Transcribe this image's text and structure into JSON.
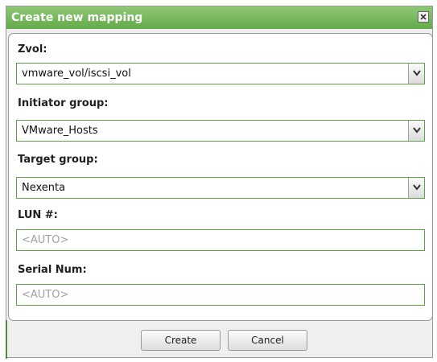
{
  "dialog": {
    "title": "Create new mapping",
    "close_icon": "close-x-icon"
  },
  "fields": {
    "zvol": {
      "label": "Zvol:",
      "value": "vmware_vol/iscsi_vol"
    },
    "initiator_group": {
      "label": "Initiator group:",
      "value": "VMware_Hosts"
    },
    "target_group": {
      "label": "Target group:",
      "value": "Nexenta"
    },
    "lun": {
      "label": "LUN #:",
      "placeholder": "<AUTO>"
    },
    "serial": {
      "label": "Serial Num:",
      "placeholder": "<AUTO>"
    }
  },
  "buttons": {
    "create": "Create",
    "cancel": "Cancel"
  },
  "colors": {
    "titlebar": "#76b85c",
    "field_border": "#5fa04a"
  }
}
